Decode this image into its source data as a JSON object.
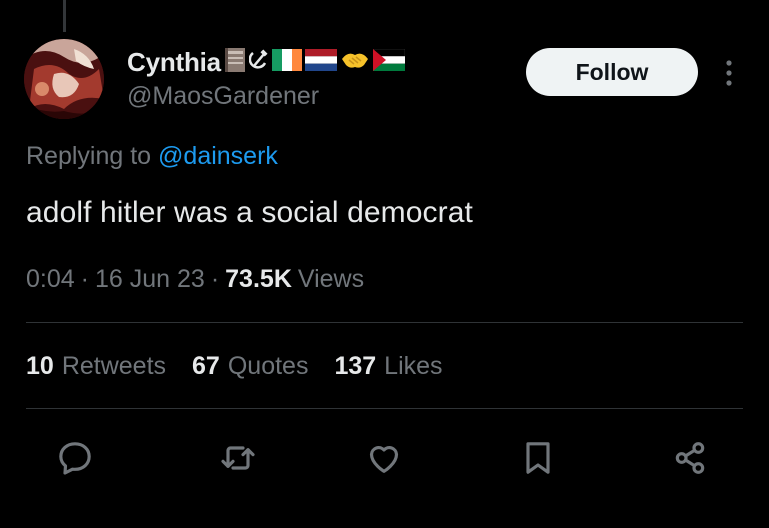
{
  "author": {
    "display_name": "Cynthia",
    "handle": "@MaosGardener",
    "name_emojis": [
      "book-emoji",
      "hammer-sickle-emoji",
      "ireland-flag-emoji",
      "netherlands-flag-emoji",
      "handshake-emoji",
      "palestine-flag-emoji"
    ]
  },
  "follow_button": {
    "label": "Follow"
  },
  "reply_context": {
    "prefix": "Replying to",
    "mention": "@dainserk"
  },
  "tweet": {
    "text": "adolf hitler was a social democrat",
    "time": "0:04",
    "separator": "·",
    "date": "16 Jun 23",
    "views_count": "73.5K",
    "views_label": "Views"
  },
  "stats": [
    {
      "count": "10",
      "label": "Retweets"
    },
    {
      "count": "67",
      "label": "Quotes"
    },
    {
      "count": "137",
      "label": "Likes"
    }
  ],
  "actions": [
    "reply-icon",
    "retweet-icon",
    "like-icon",
    "bookmark-icon",
    "share-icon"
  ],
  "colors": {
    "background": "#000000",
    "text_primary": "#e7e9ea",
    "text_secondary": "#71767b",
    "link": "#1d9bf0",
    "divider": "#2f3336",
    "follow_bg": "#eff3f4"
  }
}
